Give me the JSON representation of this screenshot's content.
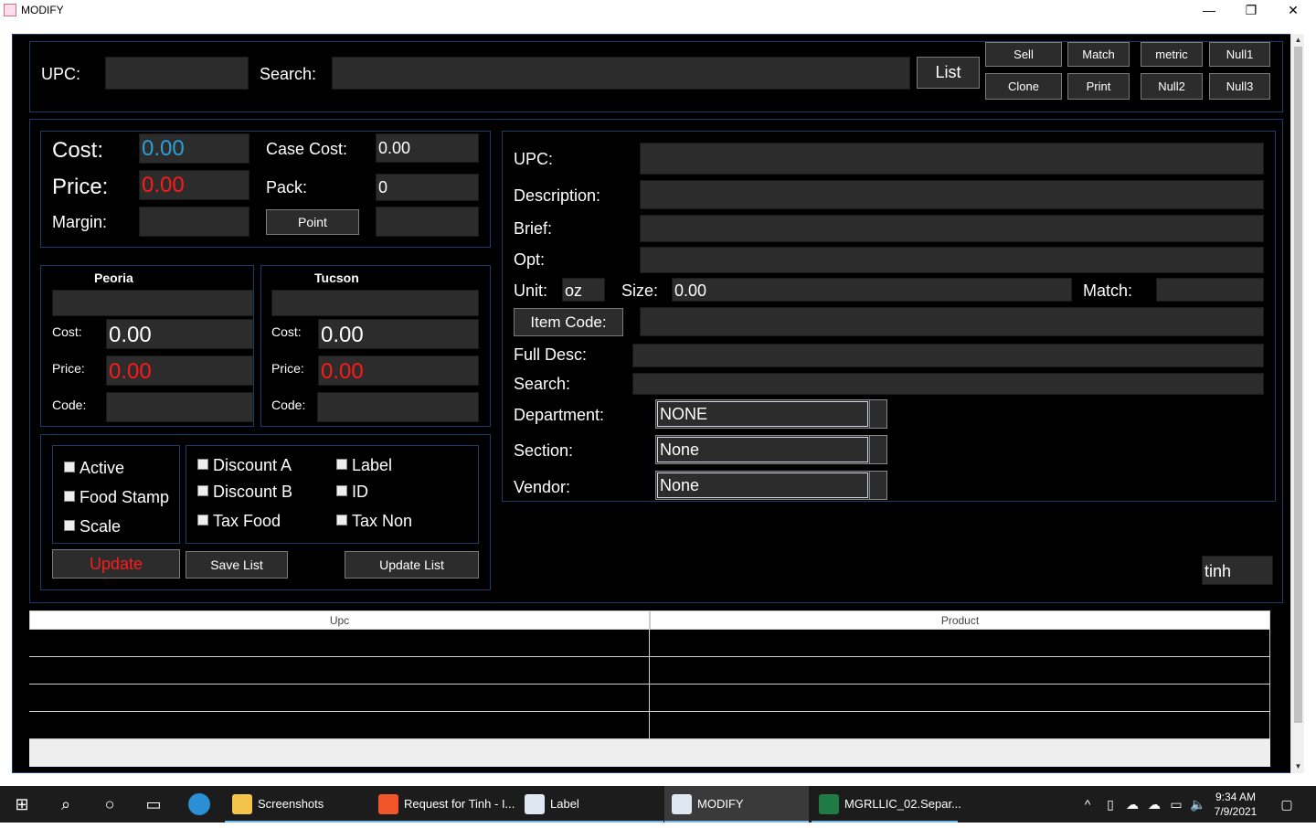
{
  "window": {
    "title": "MODIFY",
    "minimize": "—",
    "restore": "❐",
    "close": "✕"
  },
  "top": {
    "upc_label": "UPC:",
    "upc_value": "",
    "search_label": "Search:",
    "search_value": "",
    "list_button": "List",
    "buttons_row1": [
      "Sell",
      "Match",
      "metric",
      "Null1"
    ],
    "buttons_row2": [
      "Clone",
      "Print",
      "Null2",
      "Null3"
    ]
  },
  "pricing": {
    "cost_label": "Cost:",
    "cost_value": "0.00",
    "price_label": "Price:",
    "price_value": "0.00",
    "margin_label": "Margin:",
    "margin_value": "",
    "case_cost_label": "Case Cost:",
    "case_cost_value": "0.00",
    "pack_label": "Pack:",
    "pack_value": "0",
    "point_button": "Point",
    "point_value": "",
    "cost_color": "#2a9fd8",
    "price_color": "#ff1a1a"
  },
  "stores": [
    {
      "name": "Peoria",
      "top_value": "",
      "cost_label": "Cost:",
      "cost_value": "0.00",
      "price_label": "Price:",
      "price_value": "0.00",
      "code_label": "Code:",
      "code_value": ""
    },
    {
      "name": "Tucson",
      "top_value": "",
      "cost_label": "Cost:",
      "cost_value": "0.00",
      "price_label": "Price:",
      "price_value": "0.00",
      "code_label": "Code:",
      "code_value": ""
    }
  ],
  "flags": {
    "left": [
      "Active",
      "Food Stamp",
      "Scale"
    ],
    "middle_a": [
      "Discount A",
      "Discount B",
      "Tax Food"
    ],
    "middle_b": [
      "Label",
      "ID",
      "Tax Non"
    ]
  },
  "actions": {
    "update": "Update",
    "save_list": "Save List",
    "update_list": "Update List"
  },
  "detail": {
    "upc_label": "UPC:",
    "upc_value": "",
    "description_label": "Description:",
    "description_value": "",
    "brief_label": "Brief:",
    "brief_value": "",
    "opt_label": "Opt:",
    "opt_value": "",
    "unit_label": "Unit:",
    "unit_value": "oz",
    "size_label": "Size:",
    "size_value": "0.00",
    "match_label": "Match:",
    "match_value": "",
    "item_code_button": "Item Code:",
    "item_code_value": "",
    "full_desc_label": "Full Desc:",
    "full_desc_value": "",
    "search_label": "Search:",
    "search_value": "",
    "department_label": "Department:",
    "department_value": "NONE",
    "section_label": "Section:",
    "section_value": "None",
    "vendor_label": "Vendor:",
    "vendor_value": "None"
  },
  "user_field": "tinh",
  "table": {
    "columns": [
      "Upc",
      "Product"
    ],
    "rows": [
      [
        "",
        ""
      ],
      [
        "",
        ""
      ],
      [
        "",
        ""
      ],
      [
        "",
        ""
      ]
    ]
  },
  "taskbar": {
    "apps": [
      {
        "label": "Screenshots",
        "icon": "folder-icon"
      },
      {
        "label": "Request for Tinh - I...",
        "icon": "brave-icon"
      },
      {
        "label": "Label",
        "icon": "java-icon"
      },
      {
        "label": "MODIFY",
        "icon": "java-icon"
      },
      {
        "label": "MGRLLIC_02.Separ...",
        "icon": "excel-icon"
      }
    ],
    "time": "9:34 AM",
    "date": "7/9/2021"
  }
}
